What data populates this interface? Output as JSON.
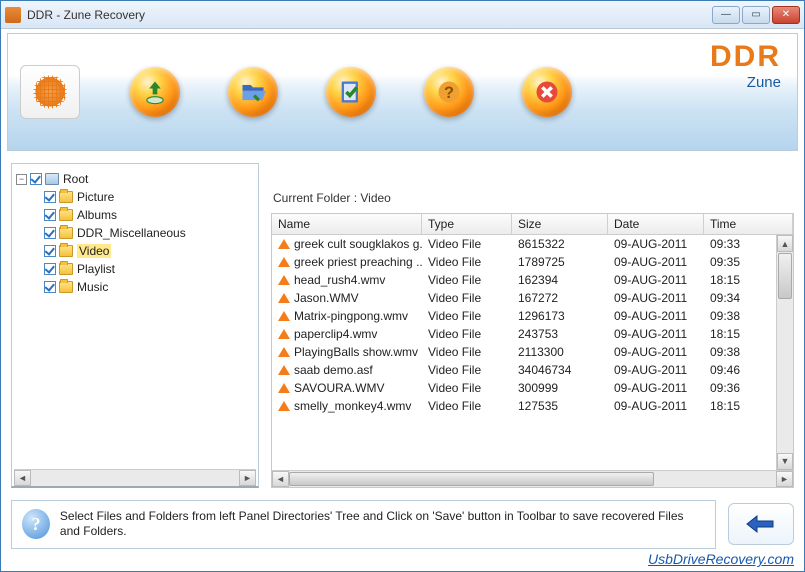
{
  "window": {
    "title": "DDR - Zune Recovery"
  },
  "brand": {
    "ddr": "DDR",
    "sub": "Zune"
  },
  "toolbar": {
    "icons": [
      "save",
      "open",
      "check",
      "help",
      "cancel"
    ]
  },
  "tree": {
    "root": "Root",
    "items": [
      {
        "label": "Picture",
        "selected": false
      },
      {
        "label": "Albums",
        "selected": false
      },
      {
        "label": "DDR_Miscellaneous",
        "selected": false
      },
      {
        "label": "Video",
        "selected": true
      },
      {
        "label": "Playlist",
        "selected": false
      },
      {
        "label": "Music",
        "selected": false
      }
    ]
  },
  "current_folder_label": "Current Folder  :   Video",
  "grid": {
    "columns": {
      "name": "Name",
      "type": "Type",
      "size": "Size",
      "date": "Date",
      "time": "Time"
    },
    "rows": [
      {
        "name": "greek cult sougklakos g...",
        "type": "Video File",
        "size": "8615322",
        "date": "09-AUG-2011",
        "time": "09:33"
      },
      {
        "name": "greek priest preaching ...",
        "type": "Video File",
        "size": "1789725",
        "date": "09-AUG-2011",
        "time": "09:35"
      },
      {
        "name": "head_rush4.wmv",
        "type": "Video File",
        "size": "162394",
        "date": "09-AUG-2011",
        "time": "18:15"
      },
      {
        "name": "Jason.WMV",
        "type": "Video File",
        "size": "167272",
        "date": "09-AUG-2011",
        "time": "09:34"
      },
      {
        "name": "Matrix-pingpong.wmv",
        "type": "Video File",
        "size": "1296173",
        "date": "09-AUG-2011",
        "time": "09:38"
      },
      {
        "name": "paperclip4.wmv",
        "type": "Video File",
        "size": "243753",
        "date": "09-AUG-2011",
        "time": "18:15"
      },
      {
        "name": "PlayingBalls show.wmv",
        "type": "Video File",
        "size": "2113300",
        "date": "09-AUG-2011",
        "time": "09:38"
      },
      {
        "name": "saab demo.asf",
        "type": "Video File",
        "size": "34046734",
        "date": "09-AUG-2011",
        "time": "09:46"
      },
      {
        "name": "SAVOURA.WMV",
        "type": "Video File",
        "size": "300999",
        "date": "09-AUG-2011",
        "time": "09:36"
      },
      {
        "name": "smelly_monkey4.wmv",
        "type": "Video File",
        "size": "127535",
        "date": "09-AUG-2011",
        "time": "18:15"
      }
    ]
  },
  "hint": "Select Files and Folders from left Panel Directories' Tree and Click on 'Save' button in Toolbar to save recovered Files and Folders.",
  "watermark": "UsbDriveRecovery.com"
}
